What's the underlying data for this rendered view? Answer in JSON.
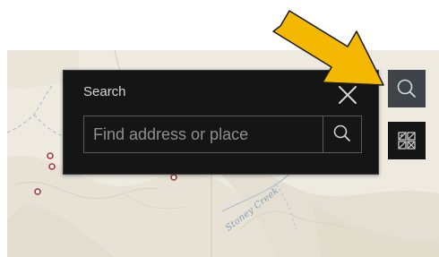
{
  "search": {
    "title": "Search",
    "placeholder": "Find address or place"
  },
  "map": {
    "creek_label": "Stoney Creek"
  },
  "icons": {
    "close": "close-icon",
    "search_submit": "search-icon",
    "search_widget": "search-icon",
    "basemap_gallery": "basemap-gallery-icon",
    "annotation": "arrow-icon"
  },
  "colors": {
    "panel_bg": "#151515",
    "active_button_bg": "#3f434a",
    "annotation_arrow": "#f5b800",
    "map_bg": "#eeeadf",
    "poi_marker": "#a23b3b"
  }
}
